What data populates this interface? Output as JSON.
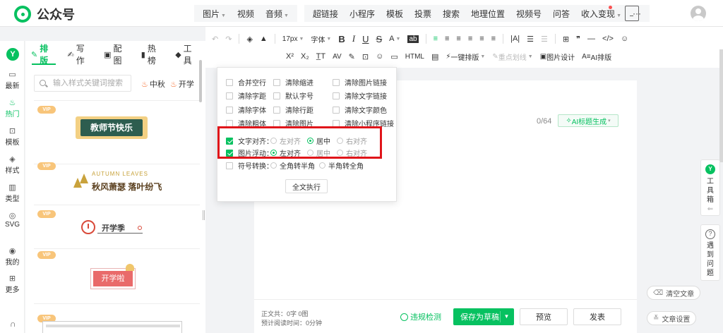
{
  "app": {
    "title": "公众号"
  },
  "topmenu": {
    "group1": [
      "图片",
      "视频",
      "音频"
    ],
    "group1_caret": [
      "图片",
      "音频"
    ],
    "group2": [
      "超链接",
      "小程序",
      "模板",
      "投票",
      "搜索",
      "地理位置",
      "视频号",
      "问答",
      "收入变现",
      "···"
    ]
  },
  "rail": {
    "items": [
      {
        "icon": "▭",
        "label": "最新"
      },
      {
        "icon": "♨",
        "label": "热门"
      },
      {
        "icon": "⊡",
        "label": "模板"
      },
      {
        "icon": "◈",
        "label": "样式"
      },
      {
        "icon": "▥",
        "label": "类型"
      },
      {
        "icon": "◎",
        "label": "SVG"
      },
      {
        "icon": "◉",
        "label": "我的"
      },
      {
        "icon": "⊞",
        "label": "更多"
      }
    ]
  },
  "panel": {
    "tabs": [
      {
        "icon": "✎",
        "label": "排版"
      },
      {
        "icon": "✍",
        "label": "写作"
      },
      {
        "icon": "▣",
        "label": "配图"
      },
      {
        "icon": "▮",
        "label": "热榜"
      },
      {
        "icon": "◆",
        "label": "工具"
      }
    ],
    "search_placeholder": "输入样式关键词搜索",
    "tags": [
      "中秋",
      "开学"
    ],
    "vip_label": "VIP",
    "cards": {
      "teacher_day": "教师节快乐",
      "autumn_sub": "AUTUMN LEAVES",
      "autumn_title": "秋风萧瑟 落叶纷飞",
      "school_open": "开学季",
      "school_btn": "开学啦"
    }
  },
  "toolbar": {
    "row1": [
      "↶",
      "↷",
      "|",
      "◈",
      "▲",
      "|",
      "17px",
      "字体",
      "B",
      "I",
      "U",
      "S",
      "A",
      "ab",
      "|",
      "≡",
      "≡",
      "≡",
      "≡",
      "≡",
      "≡",
      "|",
      "|A|",
      "☰",
      "☰",
      "|",
      "⊞",
      "❞",
      "—",
      "</>",
      "☺"
    ],
    "row2": [
      "X²",
      "X₂",
      "T̲T",
      "AV",
      "✎",
      "⊡",
      "☺",
      "▭",
      "HTML",
      "▤",
      "一键排版",
      "重点划线",
      "图片设计",
      "AI排版"
    ]
  },
  "editor": {
    "title_counter": "0/64",
    "ai_title_button": "AI标题生成"
  },
  "dropdown": {
    "checkboxes": [
      {
        "label": "合并空行",
        "checked": false
      },
      {
        "label": "清除缩进",
        "checked": false
      },
      {
        "label": "清除图片链接",
        "checked": false
      },
      {
        "label": "清除字距",
        "checked": false
      },
      {
        "label": "默认字号",
        "checked": false
      },
      {
        "label": "清除文字链接",
        "checked": false
      },
      {
        "label": "清除字体",
        "checked": false
      },
      {
        "label": "清除行距",
        "checked": false
      },
      {
        "label": "清除文字颜色",
        "checked": false
      },
      {
        "label": "清除粗体",
        "checked": false
      },
      {
        "label": "清除图片",
        "checked": false
      },
      {
        "label": "清除小程序链接",
        "checked": false
      }
    ],
    "text_align": {
      "label": "文字对齐：",
      "checked": true,
      "options": [
        "左对齐",
        "居中",
        "右对齐"
      ],
      "selected": "居中"
    },
    "image_float": {
      "label": "图片浮动：",
      "checked": true,
      "options": [
        "左对齐",
        "居中",
        "右对齐"
      ],
      "selected": "左对齐"
    },
    "symbol_convert": {
      "label": "符号转换：",
      "checked": false,
      "options": [
        "全角转半角",
        "半角转全角"
      ]
    },
    "run_button": "全文执行"
  },
  "bottom": {
    "body_stats": "正文共：0字 0图",
    "read_time": "预计阅读时间：0分钟",
    "compliance": "违规检测",
    "save_draft": "保存为草稿",
    "preview": "预览",
    "publish": "发表"
  },
  "side": {
    "toolbox": "工具箱",
    "help": "遇到问题",
    "clear_article": "清空文章",
    "article_settings": "文章设置"
  },
  "colors": {
    "brand": "#07c160",
    "highlight": "#e0151a"
  }
}
